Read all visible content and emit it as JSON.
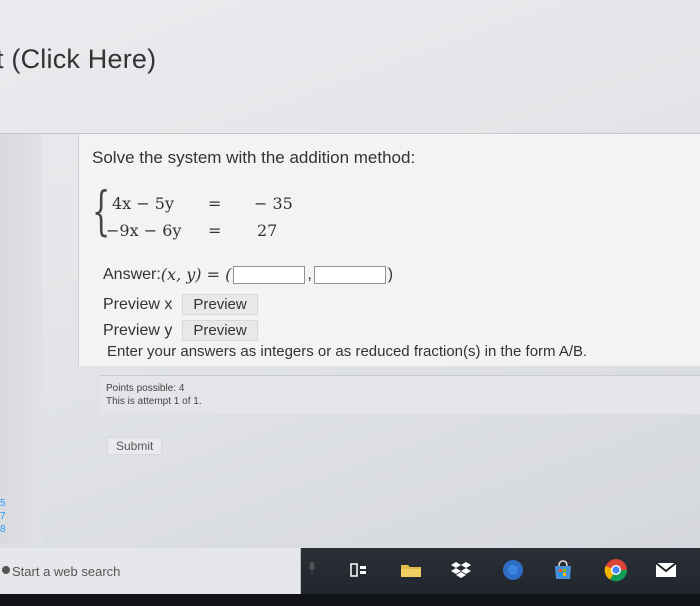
{
  "header": {
    "title": "t (Click Here)"
  },
  "question": {
    "instructions": "Solve the system with the addition method:",
    "equations": [
      {
        "lhs": "4x − 5y",
        "eq": "=",
        "rhs": "− 35"
      },
      {
        "lhs": "−9x − 6y",
        "eq": "=",
        "rhs": "27"
      }
    ],
    "answer": {
      "label": "Answer: ",
      "math": "(x, y) = (",
      "separator": ",",
      "close": ")",
      "x_value": "",
      "y_value": ""
    },
    "preview_x": {
      "label": "Preview x",
      "button": "Preview"
    },
    "preview_y": {
      "label": "Preview y",
      "button": "Preview"
    },
    "note": "Enter your answers as integers or as reduced fraction(s) in the form A/B."
  },
  "attempt": {
    "points": "Points possible: 4",
    "attempt": "This is attempt 1 of 1."
  },
  "submit_label": "Submit",
  "scroll_labels": [
    "5",
    "7",
    "8"
  ],
  "taskbar": {
    "search_placeholder": "Start a web search",
    "icons": [
      "microphone-icon",
      "task-view-icon",
      "file-explorer-icon",
      "dropbox-icon",
      "browser-icon",
      "store-icon",
      "chrome-icon",
      "mail-icon"
    ]
  }
}
